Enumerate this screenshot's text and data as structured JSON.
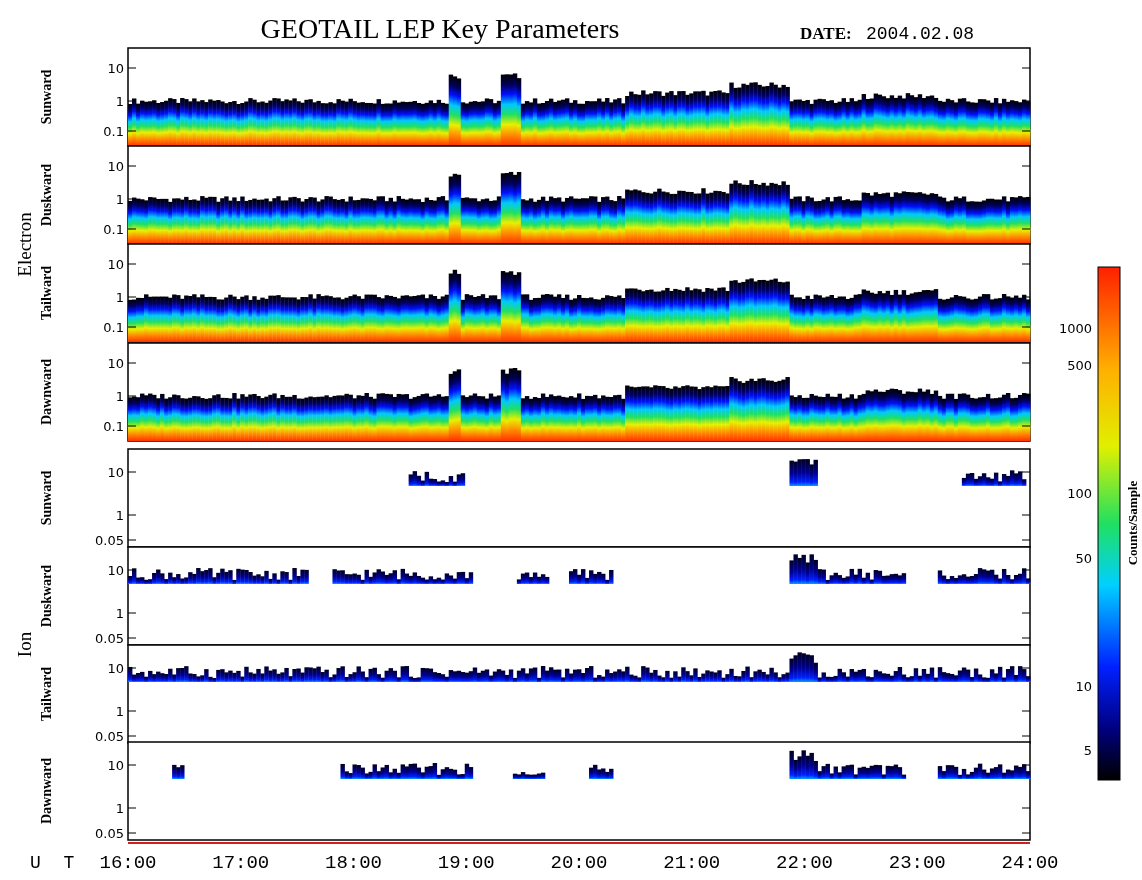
{
  "title": "GEOTAIL LEP Key Parameters",
  "date_label": "DATE:",
  "date": "2004.02.08",
  "groups": [
    {
      "name": "Electron",
      "kind": "electron",
      "panels": [
        {
          "label": "Sunward",
          "yticks": [
            "10",
            "1",
            "0.1"
          ]
        },
        {
          "label": "Duskward",
          "yticks": [
            "10",
            "1",
            "0.1"
          ]
        },
        {
          "label": "Tailward",
          "yticks": [
            "10",
            "1",
            "0.1"
          ]
        },
        {
          "label": "Dawnward",
          "yticks": [
            "10",
            "1",
            "0.1"
          ]
        }
      ]
    },
    {
      "name": "Ion",
      "kind": "ion",
      "panels": [
        {
          "label": "Sunward",
          "yticks": [
            "10",
            "1",
            "0.05"
          ]
        },
        {
          "label": "Duskward",
          "yticks": [
            "10",
            "1",
            "0.05"
          ]
        },
        {
          "label": "Tailward",
          "yticks": [
            "10",
            "1",
            "0.05"
          ]
        },
        {
          "label": "Dawnward",
          "yticks": [
            "10",
            "1",
            "0.05"
          ]
        }
      ]
    }
  ],
  "time_axis": {
    "label": "U T",
    "ticks": [
      "16:00",
      "17:00",
      "18:00",
      "19:00",
      "20:00",
      "21:00",
      "22:00",
      "23:00",
      "24:00"
    ]
  },
  "colorbar": {
    "title": "Counts/Sample",
    "ticks": [
      "1000",
      "500",
      "100",
      "50",
      "10",
      "5"
    ]
  }
}
